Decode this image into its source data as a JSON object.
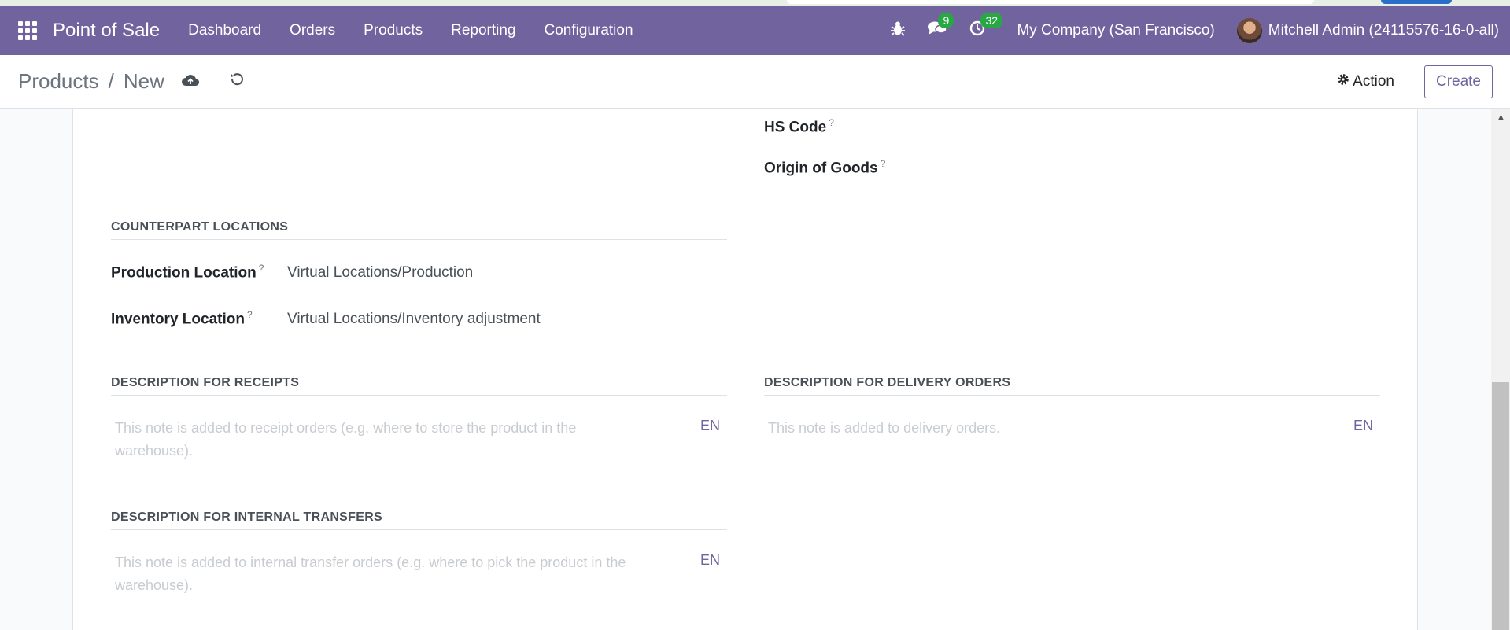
{
  "navbar": {
    "brand": "Point of Sale",
    "menu": [
      "Dashboard",
      "Orders",
      "Products",
      "Reporting",
      "Configuration"
    ],
    "messages_count": "9",
    "activities_count": "32",
    "company": "My Company (San Francisco)",
    "user": "Mitchell Admin (24115576-16-0-all)"
  },
  "control": {
    "breadcrumb_parent": "Products",
    "breadcrumb_separator": "/",
    "breadcrumb_current": "New",
    "action_label": "Action",
    "create_label": "Create"
  },
  "form": {
    "hs_code_label": "HS Code",
    "origin_label": "Origin of Goods",
    "help_mark": "?",
    "counterpart": {
      "title": "COUNTERPART LOCATIONS",
      "production_label": "Production Location",
      "production_value": "Virtual Locations/Production",
      "inventory_label": "Inventory Location",
      "inventory_value": "Virtual Locations/Inventory adjustment"
    },
    "receipts": {
      "title": "DESCRIPTION FOR RECEIPTS",
      "placeholder": "This note is added to receipt orders (e.g. where to store the product in the warehouse).",
      "lang": "EN"
    },
    "delivery": {
      "title": "DESCRIPTION FOR DELIVERY ORDERS",
      "placeholder": "This note is added to delivery orders.",
      "lang": "EN"
    },
    "internal": {
      "title": "DESCRIPTION FOR INTERNAL TRANSFERS",
      "placeholder": "This note is added to internal transfer orders (e.g. where to pick the product in the warehouse).",
      "lang": "EN"
    }
  }
}
